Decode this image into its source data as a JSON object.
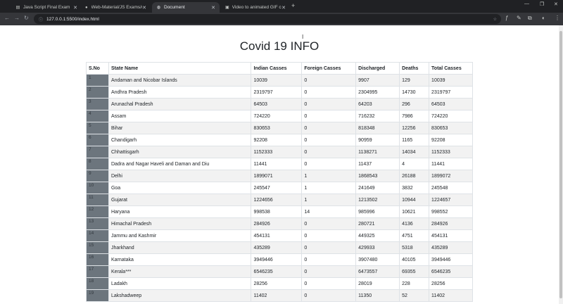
{
  "browser": {
    "tabs": [
      {
        "label": "Java Script Final Exam",
        "icon": "doc-icon"
      },
      {
        "label": "Web-Material/JS Exams/covid...",
        "icon": "github-icon"
      },
      {
        "label": "Document",
        "icon": "globe-icon"
      },
      {
        "label": "Video to animated GIF convert...",
        "icon": "video-icon"
      }
    ],
    "url": "127.0.0.1:5500/index.html"
  },
  "page": {
    "title": "Covid 19 INFO",
    "columns": [
      "S.No",
      "State Name",
      "Indian Casses",
      "Foreign Casses",
      "Discharged",
      "Deaths",
      "Total Casses"
    ],
    "rows": [
      {
        "sno": "1",
        "state": "Andaman and Nicobar Islands",
        "indian": "10039",
        "foreign": "0",
        "discharged": "9907",
        "deaths": "129",
        "total": "10039"
      },
      {
        "sno": "2",
        "state": "Andhra Pradesh",
        "indian": "2319797",
        "foreign": "0",
        "discharged": "2304995",
        "deaths": "14730",
        "total": "2319797"
      },
      {
        "sno": "3",
        "state": "Arunachal Pradesh",
        "indian": "64503",
        "foreign": "0",
        "discharged": "64203",
        "deaths": "296",
        "total": "64503"
      },
      {
        "sno": "4",
        "state": "Assam",
        "indian": "724220",
        "foreign": "0",
        "discharged": "716232",
        "deaths": "7986",
        "total": "724220"
      },
      {
        "sno": "5",
        "state": "Bihar",
        "indian": "830653",
        "foreign": "0",
        "discharged": "818348",
        "deaths": "12256",
        "total": "830653"
      },
      {
        "sno": "6",
        "state": "Chandigarh",
        "indian": "92208",
        "foreign": "0",
        "discharged": "90959",
        "deaths": "1165",
        "total": "92208"
      },
      {
        "sno": "7",
        "state": "Chhattisgarh",
        "indian": "1152333",
        "foreign": "0",
        "discharged": "1138271",
        "deaths": "14034",
        "total": "1152333"
      },
      {
        "sno": "8",
        "state": "Dadra and Nagar Haveli and Daman and Diu",
        "indian": "11441",
        "foreign": "0",
        "discharged": "11437",
        "deaths": "4",
        "total": "11441"
      },
      {
        "sno": "9",
        "state": "Delhi",
        "indian": "1899071",
        "foreign": "1",
        "discharged": "1868543",
        "deaths": "26188",
        "total": "1899072"
      },
      {
        "sno": "10",
        "state": "Goa",
        "indian": "245547",
        "foreign": "1",
        "discharged": "241649",
        "deaths": "3832",
        "total": "245548"
      },
      {
        "sno": "11",
        "state": "Gujarat",
        "indian": "1224656",
        "foreign": "1",
        "discharged": "1213502",
        "deaths": "10944",
        "total": "1224657"
      },
      {
        "sno": "12",
        "state": "Haryana",
        "indian": "998538",
        "foreign": "14",
        "discharged": "985996",
        "deaths": "10621",
        "total": "998552"
      },
      {
        "sno": "13",
        "state": "Himachal Pradesh",
        "indian": "284926",
        "foreign": "0",
        "discharged": "280721",
        "deaths": "4136",
        "total": "284926"
      },
      {
        "sno": "14",
        "state": "Jammu and Kashmir",
        "indian": "454131",
        "foreign": "0",
        "discharged": "449325",
        "deaths": "4751",
        "total": "454131"
      },
      {
        "sno": "15",
        "state": "Jharkhand",
        "indian": "435289",
        "foreign": "0",
        "discharged": "429933",
        "deaths": "5318",
        "total": "435289"
      },
      {
        "sno": "16",
        "state": "Karnataka",
        "indian": "3949446",
        "foreign": "0",
        "discharged": "3907480",
        "deaths": "40105",
        "total": "3949446"
      },
      {
        "sno": "17",
        "state": "Kerala***",
        "indian": "6546235",
        "foreign": "0",
        "discharged": "6473557",
        "deaths": "69355",
        "total": "6546235"
      },
      {
        "sno": "18",
        "state": "Ladakh",
        "indian": "28256",
        "foreign": "0",
        "discharged": "28019",
        "deaths": "228",
        "total": "28256"
      },
      {
        "sno": "19",
        "state": "Lakshadweep",
        "indian": "11402",
        "foreign": "0",
        "discharged": "11350",
        "deaths": "52",
        "total": "11402"
      }
    ]
  }
}
